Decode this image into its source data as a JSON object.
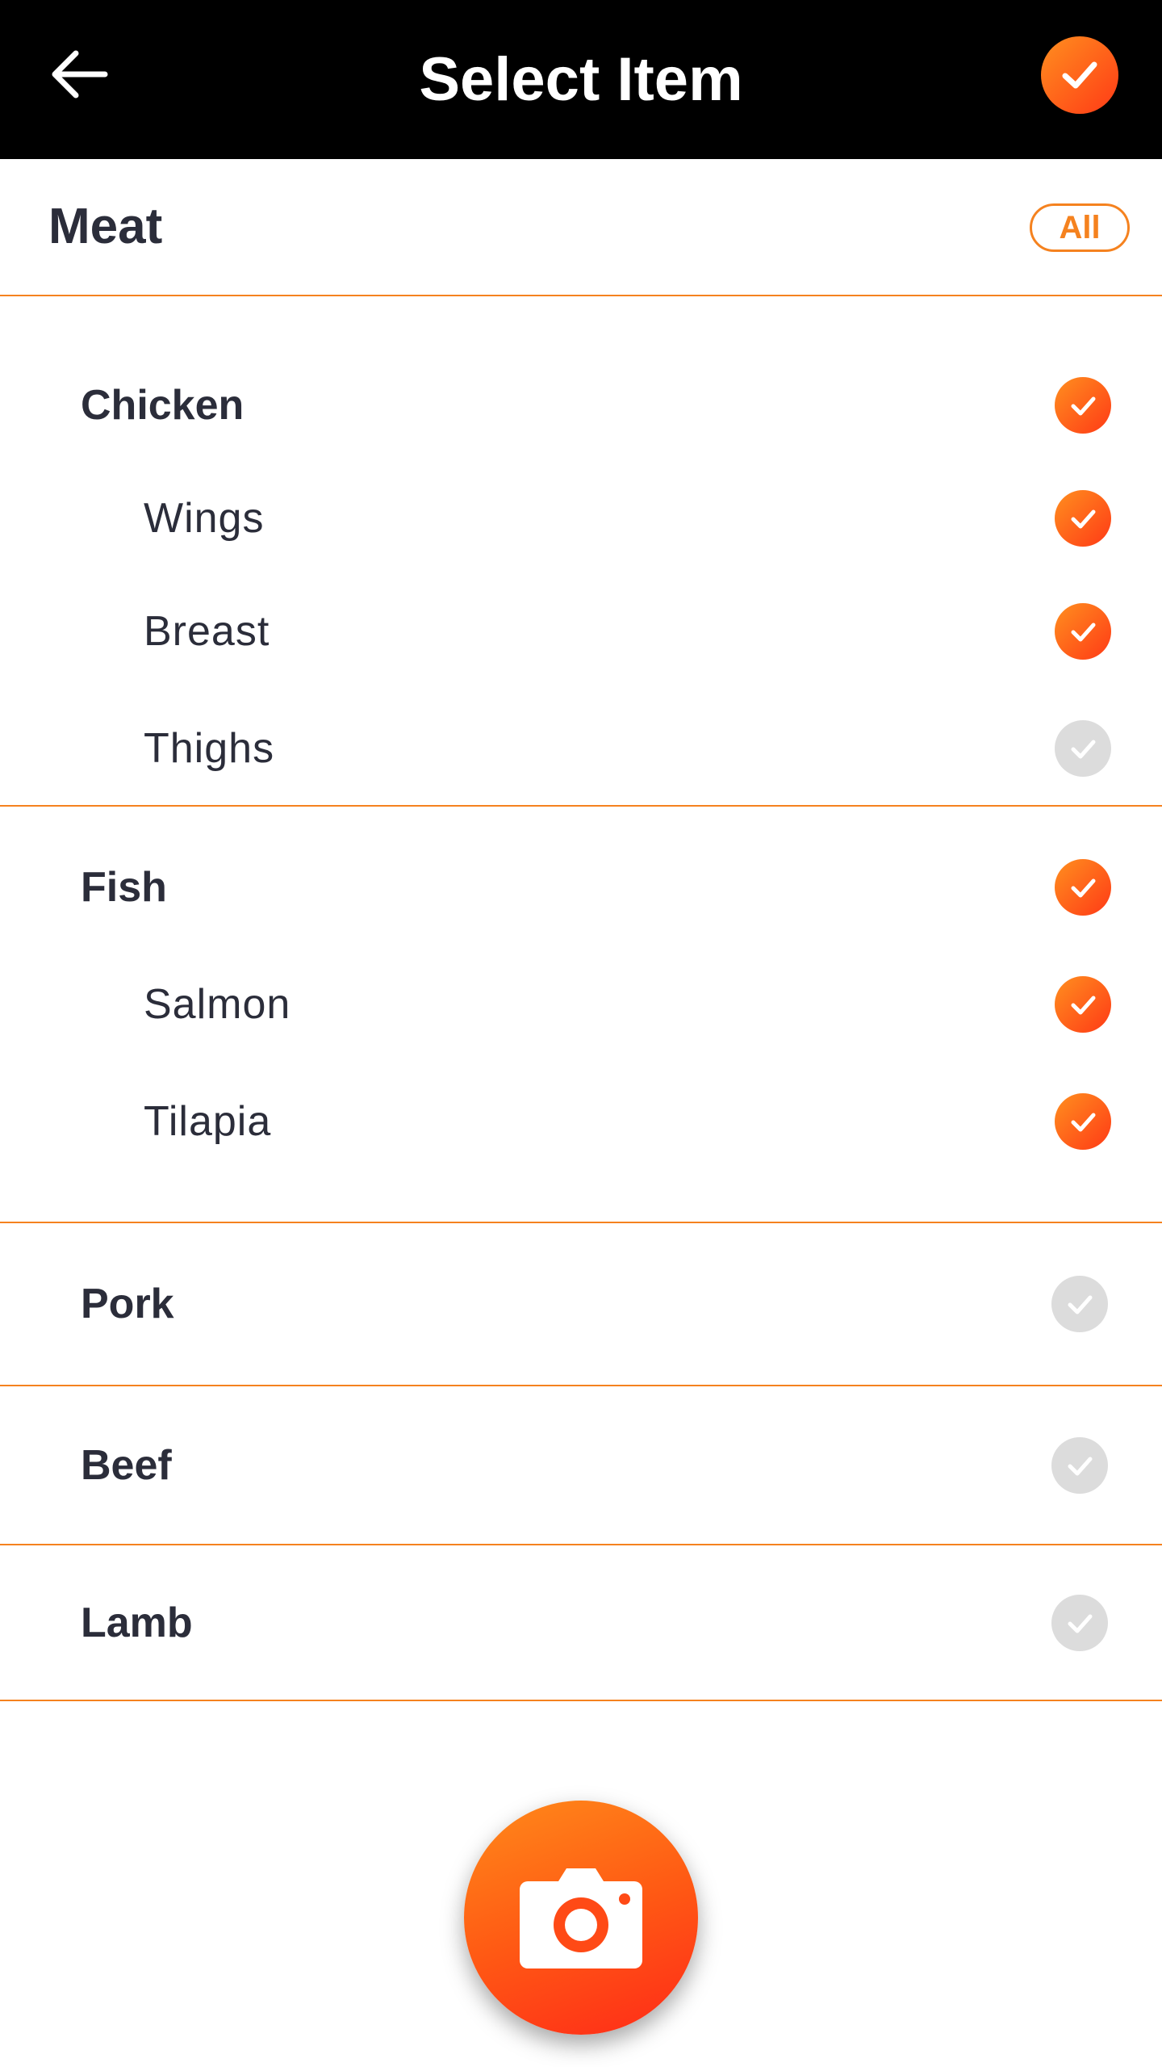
{
  "header": {
    "title": "Select Item",
    "back_icon": "arrow-left-icon",
    "confirm_icon": "check-icon"
  },
  "category": {
    "title": "Meat",
    "all_label": "All"
  },
  "groups": [
    {
      "label": "Chicken",
      "checked": true,
      "children": [
        {
          "label": "Wings",
          "checked": true
        },
        {
          "label": "Breast",
          "checked": true
        },
        {
          "label": "Thighs",
          "checked": false
        }
      ]
    },
    {
      "label": "Fish",
      "checked": true,
      "children": [
        {
          "label": "Salmon",
          "checked": true
        },
        {
          "label": "Tilapia",
          "checked": true
        }
      ]
    },
    {
      "label": "Pork",
      "checked": false,
      "children": []
    },
    {
      "label": "Beef",
      "checked": false,
      "children": []
    },
    {
      "label": "Lamb",
      "checked": false,
      "children": []
    }
  ],
  "fab": {
    "icon": "camera-icon"
  },
  "colors": {
    "accent": "#f5821f",
    "accent_gradient_start": "#ff8f1f",
    "accent_gradient_end": "#ff3a16",
    "unchecked": "#dcdcdc",
    "header_bg": "#000000",
    "text": "#2b2d3a"
  }
}
